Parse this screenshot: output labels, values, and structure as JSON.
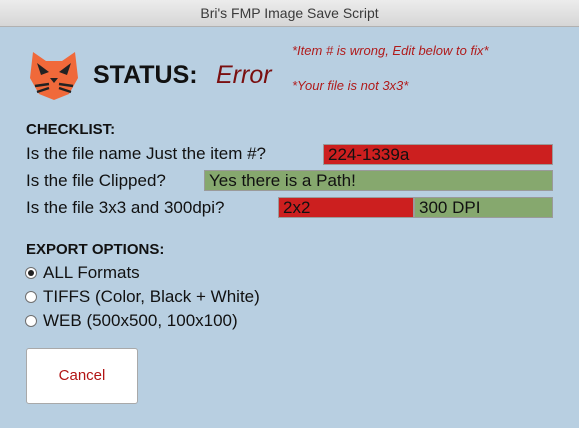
{
  "window": {
    "title": "Bri's FMP Image Save Script"
  },
  "status": {
    "label": "STATUS:",
    "value": "Error",
    "messages": [
      "*Item # is wrong, Edit below to fix*",
      "*Your file is not 3x3*"
    ]
  },
  "logo": {
    "icon": "orange-cat-logo-icon"
  },
  "checklist": {
    "title": "CHECKLIST:",
    "rows": [
      {
        "question": "Is the file name Just the item #?",
        "values": [
          "224-1339a"
        ],
        "statuses": [
          "error"
        ]
      },
      {
        "question": "Is the file Clipped?",
        "values": [
          "Yes there is a Path!"
        ],
        "statuses": [
          "ok"
        ]
      },
      {
        "question": "Is the file 3x3 and 300dpi?",
        "values": [
          "2x2",
          "300 DPI"
        ],
        "statuses": [
          "error",
          "ok"
        ]
      }
    ]
  },
  "export": {
    "title": "EXPORT OPTIONS:",
    "options": [
      {
        "label": "ALL Formats",
        "selected": true
      },
      {
        "label": "TIFFS (Color, Black + White)",
        "selected": false
      },
      {
        "label": "WEB (500x500, 100x100)",
        "selected": false
      }
    ]
  },
  "buttons": {
    "cancel_label": "Cancel"
  },
  "colors": {
    "background": "#b8cfe1",
    "error_field": "#cc1f1f",
    "ok_field": "#86a86e",
    "error_text": "#7a0f10",
    "message_text": "#b01b1b",
    "logo_orange": "#f0693a"
  }
}
